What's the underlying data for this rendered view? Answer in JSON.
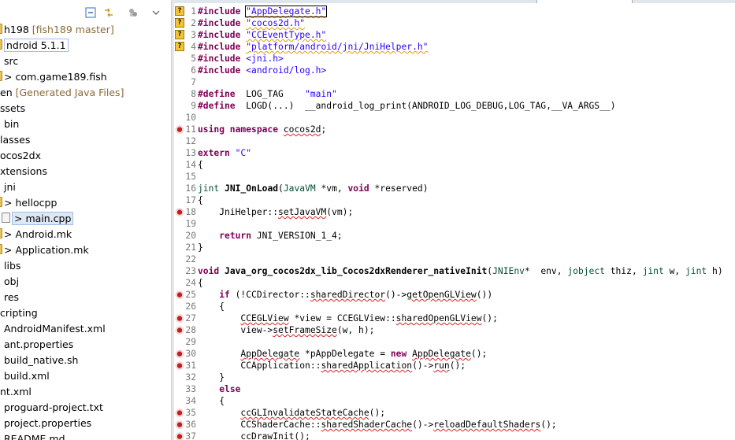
{
  "explorer": {
    "toolbar_icons": [
      "collapse-all-icon",
      "link-with-editor-icon",
      "view-menu-icon",
      "chevron-down-icon"
    ],
    "tree": [
      {
        "label": "h198",
        "decoration": "[fish189 master]",
        "indent": 0,
        "icon": "project-icon"
      },
      {
        "label": "ndroid 5.1.1",
        "decoration": "",
        "indent": 0,
        "icon": "library-icon",
        "boxed": true
      },
      {
        "label": "src",
        "decoration": "",
        "indent": 5,
        "icon": ""
      },
      {
        "label": "> com.game189.fish",
        "decoration": "",
        "indent": 0,
        "icon": "package-icon"
      },
      {
        "label": "en",
        "decoration": "[Generated Java Files]",
        "indent": 0,
        "icon": ""
      },
      {
        "label": "ssets",
        "decoration": "",
        "indent": 0,
        "icon": ""
      },
      {
        "label": "bin",
        "decoration": "",
        "indent": 5,
        "icon": ""
      },
      {
        "label": "lasses",
        "decoration": "",
        "indent": 0,
        "icon": ""
      },
      {
        "label": "ocos2dx",
        "decoration": "",
        "indent": 0,
        "icon": ""
      },
      {
        "label": "xtensions",
        "decoration": "",
        "indent": 0,
        "icon": ""
      },
      {
        "label": "jni",
        "decoration": "",
        "indent": 5,
        "icon": ""
      },
      {
        "label": "> hellocpp",
        "decoration": "",
        "indent": 0,
        "icon": "folder-icon"
      },
      {
        "label": "> main.cpp",
        "decoration": "",
        "indent": 10,
        "icon": "cpp-file-icon",
        "selected": true
      },
      {
        "label": "> Android.mk",
        "decoration": "",
        "indent": 0,
        "icon": "file-icon"
      },
      {
        "label": "> Application.mk",
        "decoration": "",
        "indent": 0,
        "icon": "file-icon"
      },
      {
        "label": "libs",
        "decoration": "",
        "indent": 5,
        "icon": ""
      },
      {
        "label": "obj",
        "decoration": "",
        "indent": 5,
        "icon": ""
      },
      {
        "label": "res",
        "decoration": "",
        "indent": 5,
        "icon": ""
      },
      {
        "label": "cripting",
        "decoration": "",
        "indent": 0,
        "icon": ""
      },
      {
        "label": "AndroidManifest.xml",
        "decoration": "",
        "indent": 5,
        "icon": ""
      },
      {
        "label": "ant.properties",
        "decoration": "",
        "indent": 5,
        "icon": ""
      },
      {
        "label": "build_native.sh",
        "decoration": "",
        "indent": 5,
        "icon": ""
      },
      {
        "label": "build.xml",
        "decoration": "",
        "indent": 5,
        "icon": ""
      },
      {
        "label": "nt.xml",
        "decoration": "",
        "indent": 0,
        "icon": ""
      },
      {
        "label": "proguard-project.txt",
        "decoration": "",
        "indent": 5,
        "icon": ""
      },
      {
        "label": "project.properties",
        "decoration": "",
        "indent": 5,
        "icon": ""
      },
      {
        "label": "README.md",
        "decoration": "",
        "indent": 5,
        "icon": ""
      }
    ]
  },
  "editor": {
    "lines": [
      {
        "n": "1",
        "mark": "q",
        "html": "<span class='kw'>#include</span> <span class='str wavy cursor-box'>\"AppDelegate.h\"</span>"
      },
      {
        "n": "2",
        "mark": "q",
        "html": "<span class='kw'>#include</span> <span class='str wavy'>\"cocos2d.h\"</span>"
      },
      {
        "n": "3",
        "mark": "q",
        "html": "<span class='kw'>#include</span> <span class='str wavy'>\"CCEventType.h\"</span>"
      },
      {
        "n": "4",
        "mark": "q",
        "html": "<span class='kw'>#include</span> <span class='str wavy'>\"platform/android/jni/JniHelper.h\"</span>"
      },
      {
        "n": "5",
        "mark": "",
        "html": "<span class='kw'>#include</span> <span class='str'>&lt;jni.h&gt;</span>"
      },
      {
        "n": "6",
        "mark": "",
        "html": "<span class='kw'>#include</span> <span class='str'>&lt;android/log.h&gt;</span>"
      },
      {
        "n": "7",
        "mark": "",
        "html": ""
      },
      {
        "n": "8",
        "mark": "",
        "html": "<span class='kw'>#define</span>  LOG_TAG    <span class='str'>\"main\"</span>"
      },
      {
        "n": "9",
        "mark": "",
        "html": "<span class='kw'>#define</span>  LOGD(...)  __android_log_print(ANDROID_LOG_DEBUG,LOG_TAG,__VA_ARGS__)"
      },
      {
        "n": "10",
        "mark": "",
        "html": ""
      },
      {
        "n": "11",
        "mark": "bug",
        "html": "<span class='kw'>using namespace</span> <span class='wavy-r'>cocos2d</span>;"
      },
      {
        "n": "12",
        "mark": "",
        "html": ""
      },
      {
        "n": "13",
        "mark": "",
        "html": "<span class='kw'>extern</span> <span class='str'>\"C\"</span>"
      },
      {
        "n": "14",
        "mark": "",
        "html": "{"
      },
      {
        "n": "15",
        "mark": "",
        "html": ""
      },
      {
        "n": "16",
        "mark": "",
        "html": "<span class='type'>jint</span> <span class='fn'>JNI_OnLoad</span>(<span class='type'>JavaVM</span> *vm, <span class='kw'>void</span> *reserved)"
      },
      {
        "n": "17",
        "mark": "",
        "html": "{"
      },
      {
        "n": "18",
        "mark": "bug",
        "html": "    JniHelper::<span class='wavy-r'>setJavaVM</span>(vm);"
      },
      {
        "n": "19",
        "mark": "",
        "html": ""
      },
      {
        "n": "20",
        "mark": "",
        "html": "    <span class='kw'>return</span> JNI_VERSION_1_4;"
      },
      {
        "n": "21",
        "mark": "",
        "html": "}"
      },
      {
        "n": "22",
        "mark": "",
        "html": ""
      },
      {
        "n": "23",
        "mark": "",
        "html": "<span class='kw'>void</span> <span class='fn'>Java_org_cocos2dx_lib_Cocos2dxRenderer_nativeInit</span>(<span class='type'>JNIEnv</span>*  env, <span class='type'>jobject</span> thiz, <span class='type'>jint</span> w, <span class='type'>jint</span> h)"
      },
      {
        "n": "24",
        "mark": "",
        "html": "{"
      },
      {
        "n": "25",
        "mark": "bug",
        "html": "    <span class='kw'>if</span> (!CCDirector::<span class='wavy-r'>sharedDirector</span>()-&gt;<span class='wavy-r'>getOpenGLView</span>())"
      },
      {
        "n": "26",
        "mark": "",
        "html": "    {"
      },
      {
        "n": "27",
        "mark": "bug",
        "html": "        <span class='wavy-r'>CCEGLView</span> *view = CCEGLView::<span class='wavy-r'>sharedOpenGLView</span>();"
      },
      {
        "n": "28",
        "mark": "bug",
        "html": "        view-&gt;<span class='wavy-r'>setFrameSize</span>(w, h);"
      },
      {
        "n": "29",
        "mark": "",
        "html": ""
      },
      {
        "n": "30",
        "mark": "bug",
        "html": "        <span class='wavy-r'>AppDelegate</span> *pAppDelegate = <span class='kw'>new</span> <span class='wavy-r'>AppDelegate</span>();"
      },
      {
        "n": "31",
        "mark": "bug",
        "html": "        CCApplication::<span class='wavy-r'>sharedApplication</span>()-&gt;<span class='wavy-r'>run</span>();"
      },
      {
        "n": "32",
        "mark": "",
        "html": "    }"
      },
      {
        "n": "33",
        "mark": "",
        "html": "    <span class='kw'>else</span>"
      },
      {
        "n": "34",
        "mark": "",
        "html": "    {"
      },
      {
        "n": "35",
        "mark": "bug",
        "html": "        <span class='wavy-r'>ccGLInvalidateStateCache</span>();"
      },
      {
        "n": "36",
        "mark": "bug",
        "html": "        CCShaderCache::<span class='wavy-r'>sharedShaderCache</span>()-&gt;<span class='wavy-r'>reloadDefaultShaders</span>();"
      },
      {
        "n": "37",
        "mark": "bug",
        "html": "        ccDrawInit();"
      }
    ]
  }
}
